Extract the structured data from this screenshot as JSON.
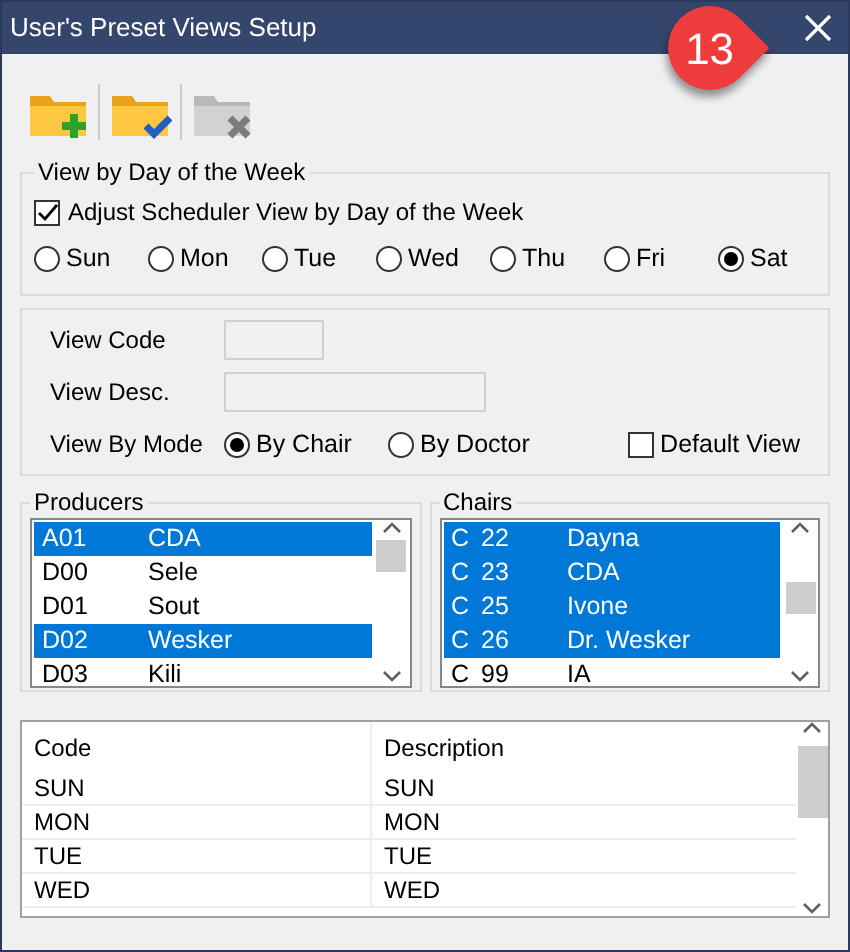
{
  "window": {
    "title": "User's Preset Views Setup"
  },
  "callout": {
    "label": "13"
  },
  "toolbar": [
    {
      "kind": "add",
      "disabled": false
    },
    {
      "kind": "confirm",
      "disabled": false
    },
    {
      "kind": "delete",
      "disabled": true
    }
  ],
  "day_group": {
    "title": "View by Day of the Week",
    "adjust": {
      "label": "Adjust Scheduler View by Day of the Week",
      "checked": true
    },
    "days": [
      {
        "label": "Sun",
        "selected": false
      },
      {
        "label": "Mon",
        "selected": false
      },
      {
        "label": "Tue",
        "selected": false
      },
      {
        "label": "Wed",
        "selected": false
      },
      {
        "label": "Thu",
        "selected": false
      },
      {
        "label": "Fri",
        "selected": false
      },
      {
        "label": "Sat",
        "selected": true
      }
    ]
  },
  "view": {
    "code_label": "View Code",
    "desc_label": "View Desc.",
    "mode_label": "View By Mode",
    "modes": [
      {
        "label": "By Chair",
        "selected": true
      },
      {
        "label": "By Doctor",
        "selected": false
      }
    ],
    "default_view": {
      "label": "Default View",
      "checked": false
    }
  },
  "producers": {
    "title": "Producers",
    "items": [
      {
        "code": "A01",
        "name": "CDA",
        "selected": true
      },
      {
        "code": "D00",
        "name": "Sele",
        "selected": false
      },
      {
        "code": "D01",
        "name": "Sout",
        "selected": false
      },
      {
        "code": "D02",
        "name": "Wesker",
        "selected": true
      },
      {
        "code": "D03",
        "name": "Kili",
        "selected": false
      }
    ]
  },
  "chairs": {
    "title": "Chairs",
    "items": [
      {
        "prefix": "C",
        "number": "22",
        "name": "Dayna",
        "selected": true
      },
      {
        "prefix": "C",
        "number": "23",
        "name": "CDA",
        "selected": true
      },
      {
        "prefix": "C",
        "number": "25",
        "name": "Ivone",
        "selected": true
      },
      {
        "prefix": "C",
        "number": "26",
        "name": "Dr. Wesker",
        "selected": true
      },
      {
        "prefix": "C",
        "number": "99",
        "name": "IA",
        "selected": false
      }
    ]
  },
  "table": {
    "columns": [
      "Code",
      "Description"
    ],
    "rows": [
      [
        "SUN",
        "SUN"
      ],
      [
        "MON",
        "MON"
      ],
      [
        "TUE",
        "TUE"
      ],
      [
        "WED",
        "WED"
      ]
    ]
  }
}
